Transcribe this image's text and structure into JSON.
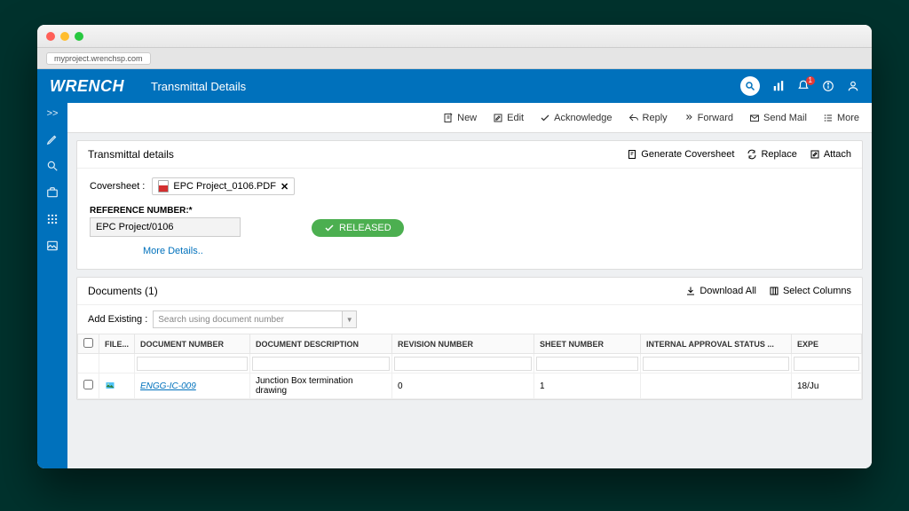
{
  "browser": {
    "url": "myproject.wrenchsp.com"
  },
  "header": {
    "logo": "WRENCH",
    "title": "Transmittal Details",
    "notification_count": "1"
  },
  "toolbar": {
    "new": "New",
    "edit": "Edit",
    "acknowledge": "Acknowledge",
    "reply": "Reply",
    "forward": "Forward",
    "send_mail": "Send Mail",
    "more": "More"
  },
  "details": {
    "title": "Transmittal details",
    "generate": "Generate Coversheet",
    "replace": "Replace",
    "attach": "Attach",
    "coversheet_label": "Coversheet :",
    "coversheet_file": "EPC Project_0106.PDF",
    "ref_label": "REFERENCE NUMBER:*",
    "ref_value": "EPC Project/0106",
    "status": "RELEASED",
    "more_link": "More Details.."
  },
  "documents": {
    "title": "Documents (1)",
    "download_all": "Download All",
    "select_columns": "Select Columns",
    "add_label": "Add Existing :",
    "search_placeholder": "Search using document number",
    "columns": {
      "file": "FILE...",
      "docnum": "DOCUMENT NUMBER",
      "docdesc": "DOCUMENT DESCRIPTION",
      "rev": "REVISION NUMBER",
      "sheet": "SHEET NUMBER",
      "approval": "INTERNAL APPROVAL STATUS ...",
      "expe": "EXPE"
    },
    "row": {
      "docnum": "ENGG-IC-009",
      "docdesc": "Junction Box termination drawing",
      "rev": "0",
      "sheet": "1",
      "approval": "",
      "expe": "18/Ju"
    }
  }
}
